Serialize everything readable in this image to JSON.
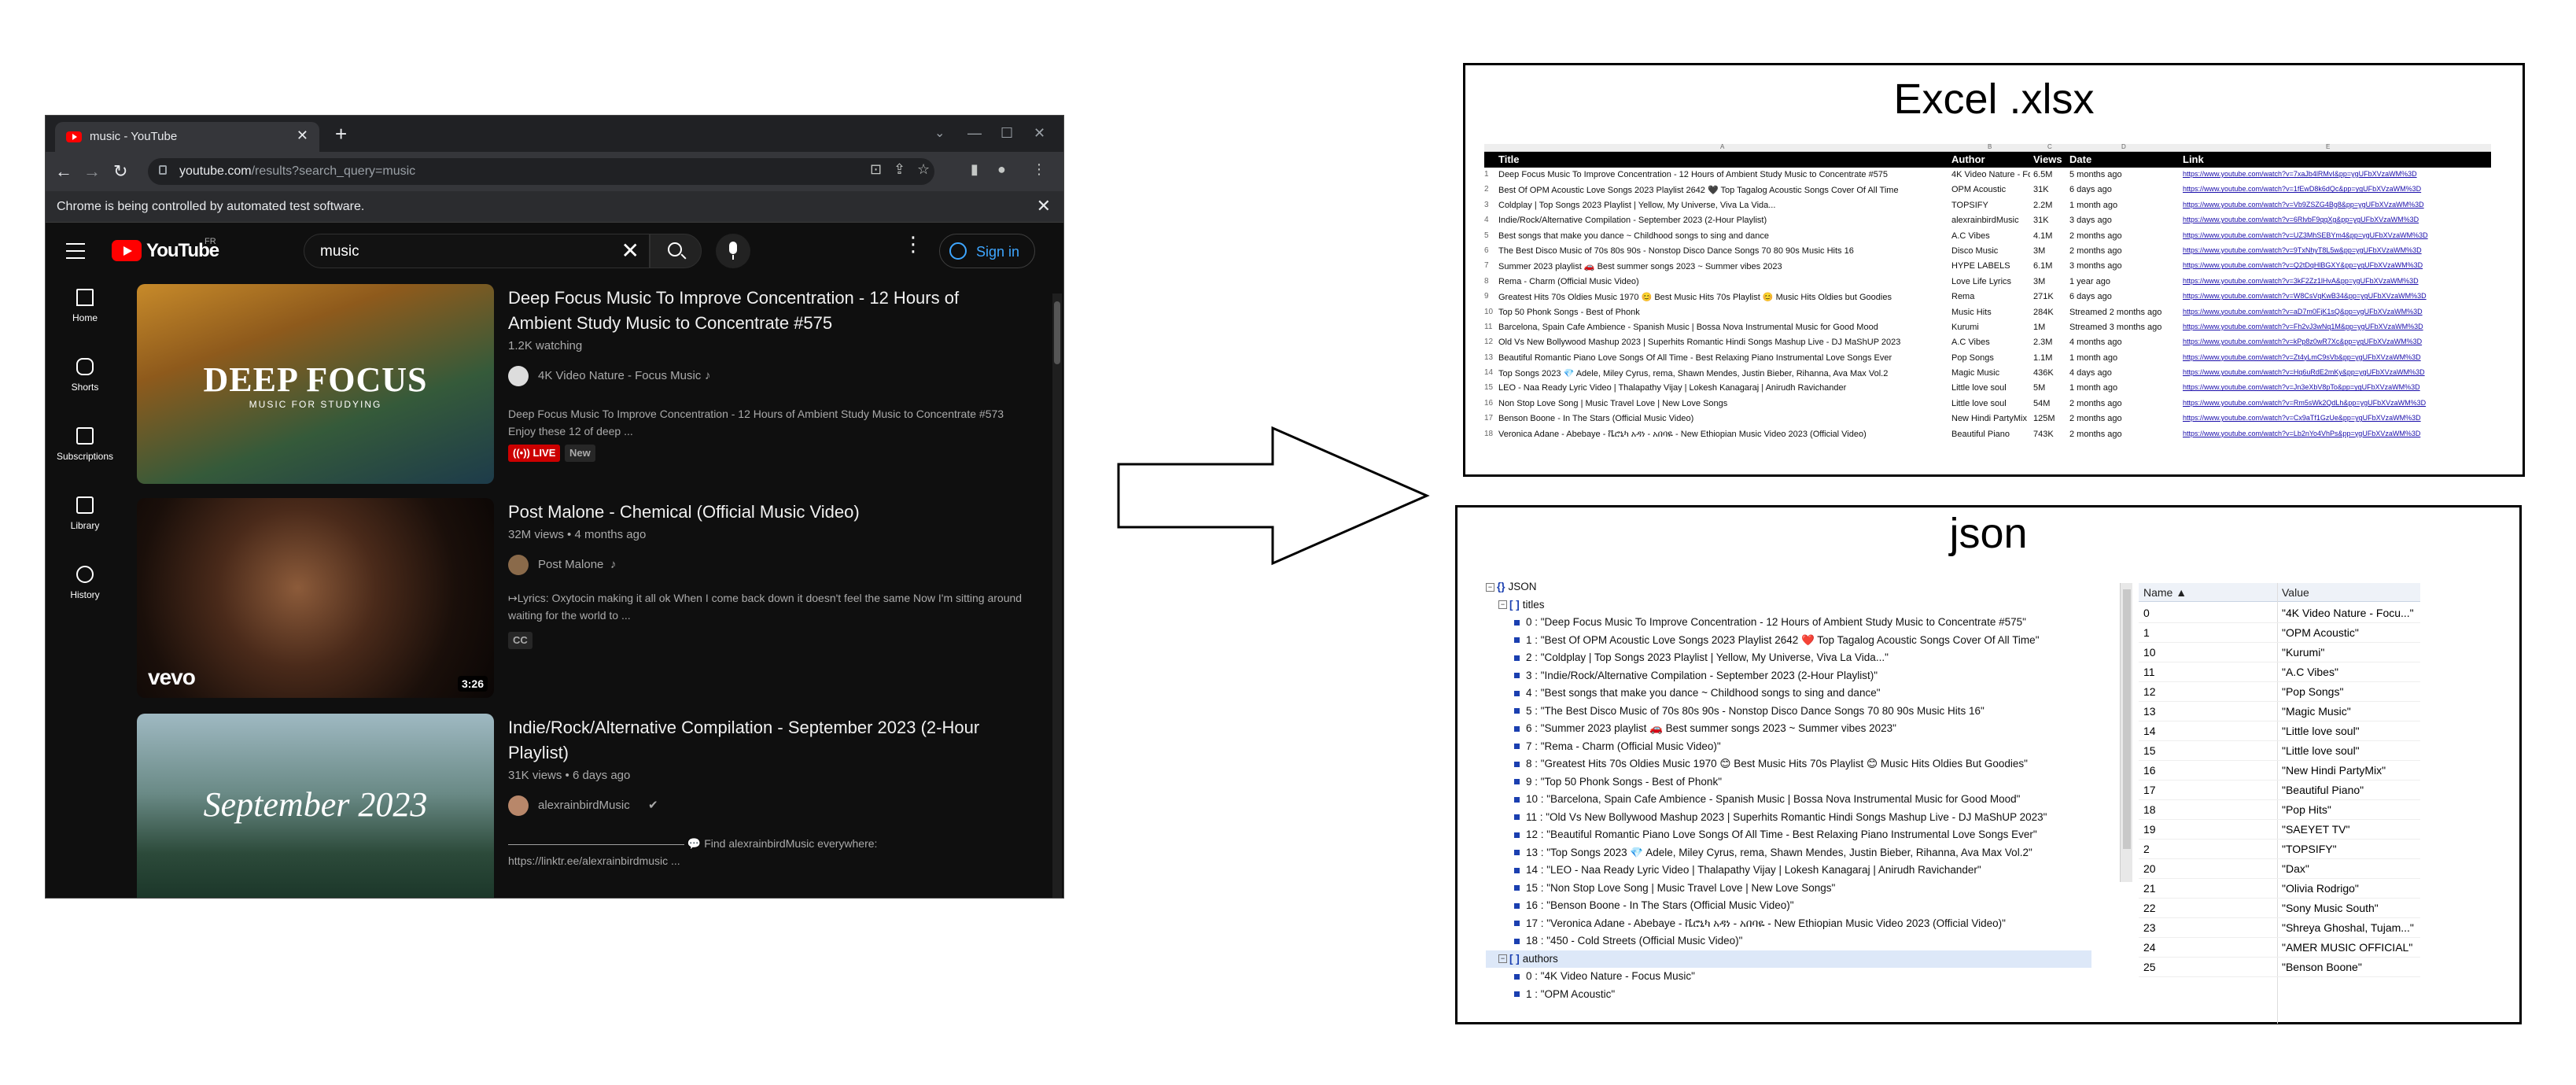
{
  "browser": {
    "tab_title": "music - YouTube",
    "new_tab": "+",
    "url_host": "youtube.com",
    "url_path": "/results?search_query=music",
    "infobar_text": "Chrome is being controlled by automated test software.",
    "close": "✕",
    "window_min": "—",
    "window_max": "☐",
    "window_close": "✕"
  },
  "youtube": {
    "logo_text": "YouTube",
    "country": "FR",
    "search_value": "music",
    "sign_in": "Sign in",
    "sidebar": [
      {
        "label": "Home"
      },
      {
        "label": "Shorts"
      },
      {
        "label": "Subscriptions"
      },
      {
        "label": "Library"
      },
      {
        "label": "History"
      }
    ],
    "results": [
      {
        "title": "Deep Focus Music To Improve Concentration - 12 Hours of Ambient Study Music to Concentrate #575",
        "meta": "1.2K watching",
        "channel": "4K Video Nature - Focus Music",
        "desc": "Deep Focus Music To Improve Concentration - 12 Hours of Ambient Study Music to Concentrate #573 Enjoy these 12 of deep ...",
        "badge_live": "LIVE",
        "badge_new": "New",
        "thumb_text": "DEEP FOCUS",
        "thumb_sub": "MUSIC FOR STUDYING"
      },
      {
        "title": "Post Malone - Chemical (Official Music Video)",
        "meta": "32M views • 4 months ago",
        "channel": "Post Malone",
        "desc": "↦Lyrics: Oxytocin making it all ok When I come back down it doesn't feel the same Now I'm sitting around waiting for the world to ...",
        "badge_cc": "CC",
        "duration": "3:26",
        "thumb_text": "vevo"
      },
      {
        "title": "Indie/Rock/Alternative Compilation - September 2023 (2-Hour Playlist)",
        "meta": "31K views • 6 days ago",
        "channel": "alexrainbirdMusic",
        "desc": "———————————————— 💬 Find alexrainbirdMusic everywhere: https://linktr.ee/alexrainbirdmusic ...",
        "thumb_text": "September 2023"
      }
    ]
  },
  "excel": {
    "title": "Excel .xlsx",
    "col_letters": [
      "A",
      "B",
      "C",
      "D",
      "E"
    ],
    "headers": [
      "Title",
      "Author",
      "Views",
      "Date",
      "Link"
    ],
    "rows": [
      [
        "Deep Focus Music To Improve Concentration - 12 Hours of Ambient Study Music to Concentrate #575",
        "4K Video Nature - Focus Music",
        "6.5M",
        "5 months ago",
        "https://www.youtube.com/watch?v=7xaJb4lRMvI&pp=ygUFbXVzaWM%3D"
      ],
      [
        "Best Of OPM Acoustic Love Songs 2023 Playlist 2642 🖤 Top Tagalog Acoustic Songs Cover Of All Time",
        "OPM Acoustic",
        "31K",
        "6 days ago",
        "https://www.youtube.com/watch?v=1fEwD8k6dQc&pp=ygUFbXVzaWM%3D"
      ],
      [
        "Coldplay | Top Songs 2023 Playlist | Yellow, My Universe, Viva La Vida...",
        "TOPSIFY",
        "2.2M",
        "1 month ago",
        "https://www.youtube.com/watch?v=Vb9ZSZG4Bg8&pp=ygUFbXVzaWM%3D"
      ],
      [
        "Indie/Rock/Alternative Compilation - September 2023 (2-Hour Playlist)",
        "alexrainbirdMusic",
        "31K",
        "3 days ago",
        "https://www.youtube.com/watch?v=6RlvbF9qqXg&pp=ygUFbXVzaWM%3D"
      ],
      [
        "Best songs that make you dance ~ Childhood songs to sing and dance",
        "A.C Vibes",
        "4.1M",
        "2 months ago",
        "https://www.youtube.com/watch?v=UZ3MhSEBYm4&pp=ygUFbXVzaWM%3D"
      ],
      [
        "The Best Disco Music of 70s 80s 90s - Nonstop Disco Dance Songs 70 80 90s Music Hits 16",
        "Disco Music",
        "3M",
        "2 months ago",
        "https://www.youtube.com/watch?v=9TxNhyT8L5w&pp=ygUFbXVzaWM%3D"
      ],
      [
        "Summer 2023 playlist 🚗 Best summer songs 2023 ~ Summer vibes 2023",
        "HYPE LABELS",
        "6.1M",
        "3 months ago",
        "https://www.youtube.com/watch?v=Q2tDqHlBGXY&pp=ygUFbXVzaWM%3D"
      ],
      [
        "Rema - Charm (Official Music Video)",
        "Love Life Lyrics",
        "3M",
        "1 year ago",
        "https://www.youtube.com/watch?v=3kF2Zz1lHvA&pp=ygUFbXVzaWM%3D"
      ],
      [
        "Greatest Hits 70s Oldies Music 1970 😊 Best Music Hits 70s Playlist 😊 Music Hits Oldies but Goodies",
        "Rema",
        "271K",
        "6 days ago",
        "https://www.youtube.com/watch?v=W8CsVqKwB34&pp=ygUFbXVzaWM%3D"
      ],
      [
        "Top 50 Phonk Songs - Best of Phonk",
        "Music Hits",
        "284K",
        "Streamed 2 months ago",
        "https://www.youtube.com/watch?v=aD7m0FjK1sQ&pp=ygUFbXVzaWM%3D"
      ],
      [
        "Barcelona, Spain Cafe Ambience - Spanish Music | Bossa Nova Instrumental Music for Good Mood",
        "Kurumi",
        "1M",
        "Streamed 3 months ago",
        "https://www.youtube.com/watch?v=Fh2vJ3wNq1M&pp=ygUFbXVzaWM%3D"
      ],
      [
        "Old Vs New Bollywood Mashup 2023 | Superhits Romantic Hindi Songs Mashup Live - DJ MaShUP 2023",
        "A.C Vibes",
        "2.3M",
        "4 months ago",
        "https://www.youtube.com/watch?v=kPp8z0wR7Xc&pp=ygUFbXVzaWM%3D"
      ],
      [
        "Beautiful Romantic Piano Love Songs Of All Time - Best Relaxing Piano Instrumental Love Songs Ever",
        "Pop Songs",
        "1.1M",
        "1 month ago",
        "https://www.youtube.com/watch?v=Zt4yLmC9sVb&pp=ygUFbXVzaWM%3D"
      ],
      [
        "Top Songs 2023 💎 Adele, Miley Cyrus, rema, Shawn Mendes, Justin Bieber, Rihanna, Ava Max Vol.2",
        "Magic Music",
        "436K",
        "4 days ago",
        "https://www.youtube.com/watch?v=Hq6uRdE2mKy&pp=ygUFbXVzaWM%3D"
      ],
      [
        "LEO - Naa Ready Lyric Video | Thalapathy Vijay | Lokesh Kanagaraj | Anirudh Ravichander",
        "Little love soul",
        "5M",
        "1 month ago",
        "https://www.youtube.com/watch?v=Jn3eXbV8pTo&pp=ygUFbXVzaWM%3D"
      ],
      [
        "Non Stop Love Song | Music Travel Love | New Love Songs",
        "Little love soul",
        "54M",
        "2 months ago",
        "https://www.youtube.com/watch?v=Rm5sWk2QdLh&pp=ygUFbXVzaWM%3D"
      ],
      [
        "Benson Boone - In The Stars (Official Music Video)",
        "New Hindi PartyMix",
        "125M",
        "2 months ago",
        "https://www.youtube.com/watch?v=Cx9aTf1GzUe&pp=ygUFbXVzaWM%3D"
      ],
      [
        "Veronica Adane - Abebaye - ቬሮኒካ አዳነ - አበባዬ - New Ethiopian Music Video 2023 (Official Video)",
        "Beautiful Piano",
        "743K",
        "2 months ago",
        "https://www.youtube.com/watch?v=Lb2nYo4VhPs&pp=ygUFbXVzaWM%3D"
      ]
    ]
  },
  "json_view": {
    "title": "json",
    "root": "JSON",
    "titles_key": "titles",
    "authors_key": "authors",
    "titles": [
      "0 : \"Deep Focus Music To Improve Concentration - 12 Hours of Ambient Study Music to Concentrate #575\"",
      "1 : \"Best Of OPM Acoustic Love Songs 2023 Playlist 2642 ❤️ Top Tagalog Acoustic Songs Cover Of All Time\"",
      "2 : \"Coldplay | Top Songs 2023 Playlist | Yellow, My Universe, Viva La Vida...\"",
      "3 : \"Indie/Rock/Alternative Compilation - September 2023 (2-Hour Playlist)\"",
      "4 : \"Best songs that make you dance ~ Childhood songs to sing and dance\"",
      "5 : \"The Best Disco Music of 70s 80s 90s - Nonstop Disco Dance Songs 70 80 90s Music Hits 16\"",
      "6 : \"Summer 2023 playlist 🚗 Best summer songs 2023 ~ Summer vibes 2023\"",
      "7 : \"Rema - Charm (Official Music Video)\"",
      "8 : \"Greatest Hits 70s Oldies Music 1970 😊 Best Music Hits 70s Playlist 😊 Music Hits Oldies But Goodies\"",
      "9 : \"Top 50 Phonk Songs - Best of Phonk\"",
      "10 : \"Barcelona, Spain Cafe Ambience - Spanish Music | Bossa Nova Instrumental Music for Good Mood\"",
      "11 : \"Old Vs New Bollywood Mashup 2023 | Superhits Romantic Hindi Songs Mashup Live - DJ MaShUP 2023\"",
      "12 : \"Beautiful Romantic Piano Love Songs Of All Time - Best Relaxing Piano Instrumental Love Songs Ever\"",
      "13 : \"Top Songs 2023 💎 Adele, Miley Cyrus, rema, Shawn Mendes, Justin Bieber, Rihanna, Ava Max Vol.2\"",
      "14 : \"LEO - Naa Ready Lyric Video | Thalapathy Vijay | Lokesh Kanagaraj | Anirudh Ravichander\"",
      "15 : \"Non Stop Love Song | Music Travel Love | New Love Songs\"",
      "16 : \"Benson Boone - In The Stars (Official Music Video)\"",
      "17 : \"Veronica Adane - Abebaye - ቬሮኒካ አዳነ - አበባዬ - New Ethiopian Music Video 2023 (Official Video)\"",
      "18 : \"450 - Cold Streets (Official Music Video)\""
    ],
    "authors": [
      "0 : \"4K Video Nature - Focus Music\"",
      "1 : \"OPM Acoustic\""
    ],
    "grid_headers": {
      "name": "Name ▲",
      "value": "Value"
    },
    "grid_rows": [
      [
        "0",
        "\"4K Video Nature - Focu...\""
      ],
      [
        "1",
        "\"OPM Acoustic\""
      ],
      [
        "10",
        "\"Kurumi\""
      ],
      [
        "11",
        "\"A.C Vibes\""
      ],
      [
        "12",
        "\"Pop Songs\""
      ],
      [
        "13",
        "\"Magic Music\""
      ],
      [
        "14",
        "\"Little love soul\""
      ],
      [
        "15",
        "\"Little love soul\""
      ],
      [
        "16",
        "\"New Hindi PartyMix\""
      ],
      [
        "17",
        "\"Beautiful Piano\""
      ],
      [
        "18",
        "\"Pop Hits\""
      ],
      [
        "19",
        "\"SAEYET TV\""
      ],
      [
        "2",
        "\"TOPSIFY\""
      ],
      [
        "20",
        "\"Dax\""
      ],
      [
        "21",
        "\"Olivia Rodrigo\""
      ],
      [
        "22",
        "\"Sony Music South\""
      ],
      [
        "23",
        "\"Shreya Ghoshal, Tujam...\""
      ],
      [
        "24",
        "\"AMER MUSIC OFFICIAL\""
      ],
      [
        "25",
        "\"Benson Boone\""
      ]
    ]
  },
  "colors": {
    "youtube_red": "#ff0000",
    "link_blue": "#3ea6ff",
    "live_red": "#cc0000"
  }
}
